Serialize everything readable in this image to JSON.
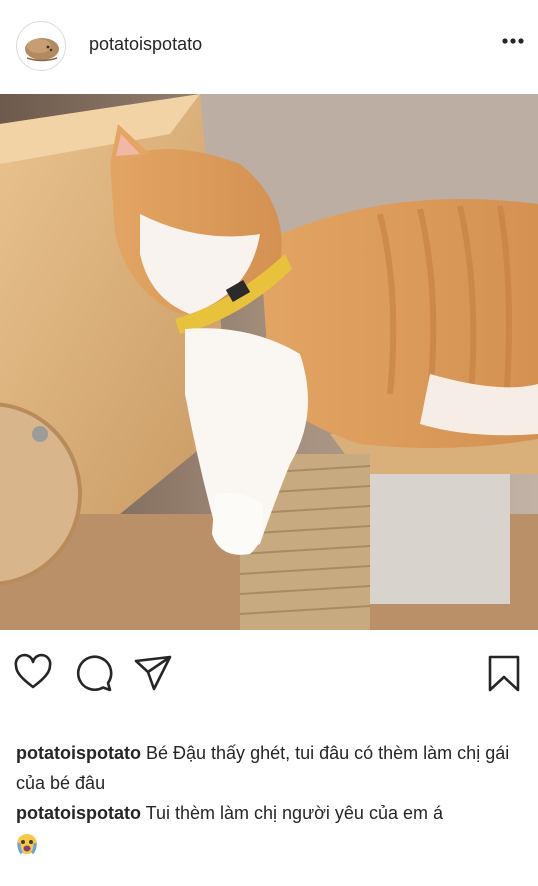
{
  "post": {
    "username": "potatoispotato",
    "more_icon": "more-horizontal-icon",
    "photo_alt": "",
    "icons": {
      "like": "heart-icon",
      "comment": "comment-bubble-icon",
      "share": "paper-plane-icon",
      "save": "bookmark-icon"
    }
  },
  "captions": [
    {
      "user": "potatoispotato",
      "text": "Bé Đậu thấy ghét, tui đâu có thèm làm chị gái của bé đâu"
    },
    {
      "user": "potatoispotato",
      "text": "Tui thèm làm chị người yêu của em á",
      "emoji": "crying-face-emoji"
    }
  ],
  "colors": {
    "text": "#262626",
    "border": "#dbdbdb",
    "background": "#ffffff"
  }
}
